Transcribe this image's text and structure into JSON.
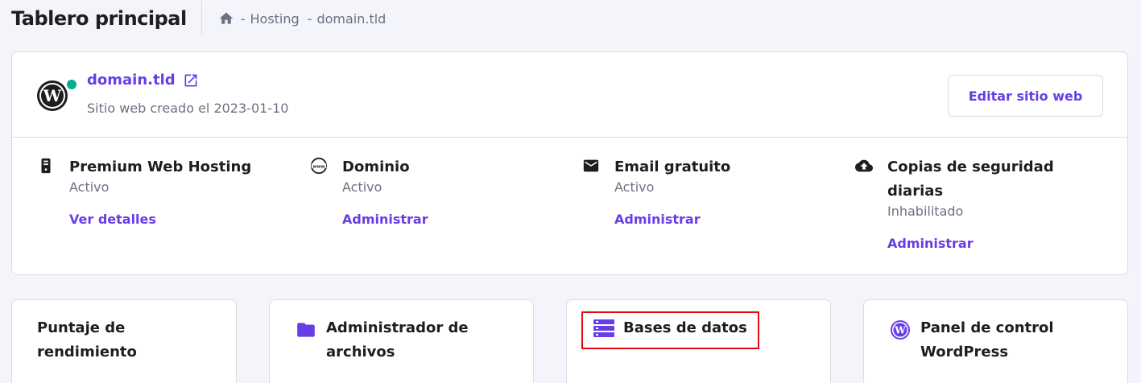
{
  "header": {
    "title": "Tablero principal",
    "breadcrumb": [
      {
        "sep": "-",
        "label": "Hosting"
      },
      {
        "sep": "-",
        "label": "domain.tld"
      }
    ]
  },
  "site": {
    "domain": "domain.tld",
    "created": "Sitio web creado el 2023-01-10",
    "status_color": "#00b090",
    "edit_label": "Editar sitio web"
  },
  "services": [
    {
      "icon": "server-icon",
      "title": "Premium Web Hosting",
      "status": "Activo",
      "link": "Ver detalles"
    },
    {
      "icon": "www-globe-icon",
      "title": "Dominio",
      "status": "Activo",
      "link": "Administrar"
    },
    {
      "icon": "envelope-icon",
      "title": "Email gratuito",
      "status": "Activo",
      "link": "Administrar"
    },
    {
      "icon": "cloud-upload-icon",
      "title": "Copias de seguridad diarias",
      "status": "Inhabilitado",
      "link": "Administrar"
    }
  ],
  "tools": [
    {
      "label": "Puntaje de rendimiento"
    },
    {
      "icon": "folder-icon",
      "label": "Administrador de archivos"
    },
    {
      "icon": "database-icon",
      "label": "Bases de datos",
      "highlighted": true
    },
    {
      "icon": "wordpress-icon",
      "label": "Panel de control WordPress"
    }
  ],
  "colors": {
    "accent": "#673de6",
    "highlight": "#e50914",
    "text": "#1d1e20",
    "muted": "#6d7081"
  }
}
